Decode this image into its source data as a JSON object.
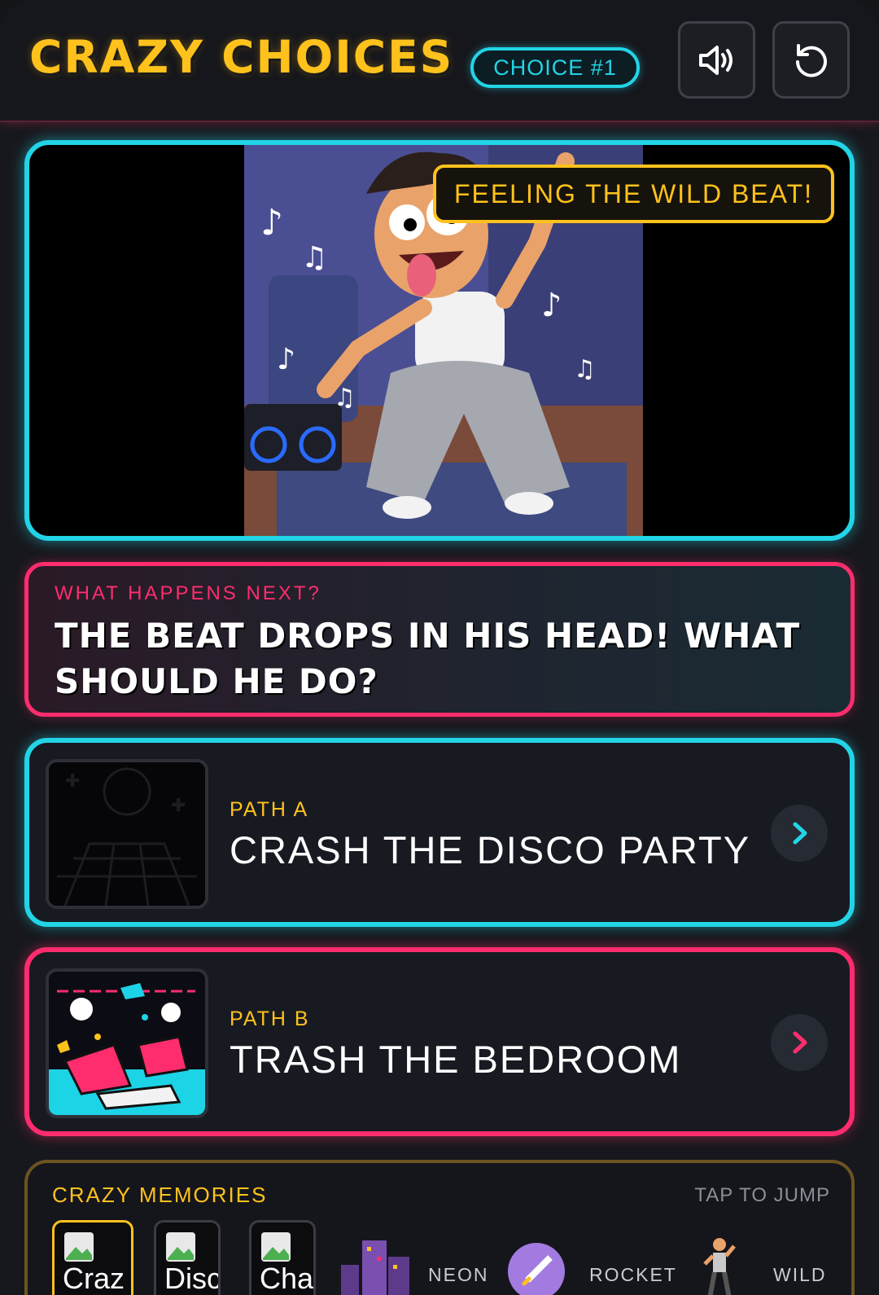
{
  "header": {
    "title": "CRAZY CHOICES",
    "choice_badge": "CHOICE #1",
    "sound_icon": "volume-icon",
    "restart_icon": "restart-icon"
  },
  "scene": {
    "caption": "FEELING THE WILD BEAT!",
    "image": "dancing-guy-illustration"
  },
  "question": {
    "label": "WHAT HAPPENS NEXT?",
    "text": "THE BEAT DROPS IN HIS HEAD! WHAT SHOULD HE DO?"
  },
  "options": [
    {
      "label": "PATH A",
      "text": "CRASH THE DISCO PARTY",
      "thumb": "disco-floor-thumbnail",
      "color": "#22d4e6"
    },
    {
      "label": "PATH B",
      "text": "TRASH THE BEDROOM",
      "thumb": "messy-bedroom-thumbnail",
      "color": "#ff2d6e"
    }
  ],
  "memories": {
    "title": "CRAZY MEMORIES",
    "hint": "TAP TO JUMP",
    "cards": [
      {
        "text": "Craz"
      },
      {
        "text": "Disc"
      },
      {
        "text": "Cha"
      }
    ],
    "words": [
      "NEON",
      "ROCKET",
      "WILD"
    ]
  },
  "colors": {
    "accent_yellow": "#ffc21c",
    "accent_cyan": "#22d4e6",
    "accent_pink": "#ff2d6e",
    "background": "#17181d"
  }
}
